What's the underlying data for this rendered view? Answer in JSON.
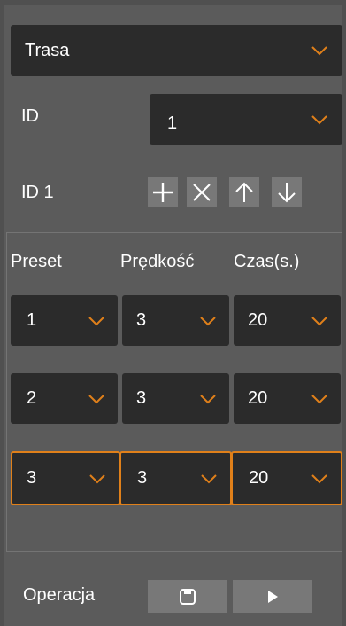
{
  "mode_select": {
    "value": "Trasa"
  },
  "id_row": {
    "label": "ID",
    "value": "1"
  },
  "route_row": {
    "label": "ID 1"
  },
  "table": {
    "headers": {
      "preset": "Preset",
      "speed": "Prędkość",
      "time": "Czas(s.)"
    },
    "rows": [
      {
        "preset": "1",
        "speed": "3",
        "time": "20"
      },
      {
        "preset": "2",
        "speed": "3",
        "time": "20"
      },
      {
        "preset": "3",
        "speed": "3",
        "time": "20"
      }
    ]
  },
  "operation": {
    "label": "Operacja"
  },
  "colors": {
    "accent": "#e0801a",
    "field_bg": "#2b2b2b",
    "button_bg": "#787878",
    "panel_bg": "#5b5b5b"
  }
}
